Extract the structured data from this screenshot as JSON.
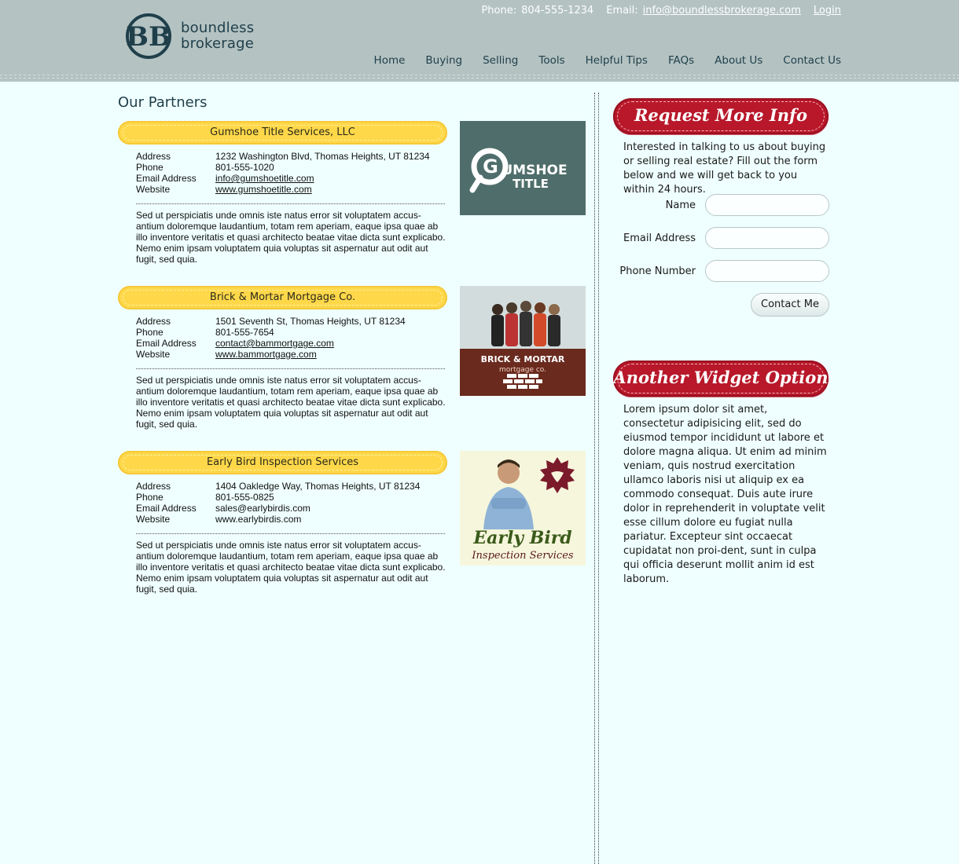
{
  "header": {
    "logo": {
      "mark": "BB",
      "line1": "boundless",
      "line2": "brokerage"
    },
    "phone_label": "Phone:",
    "phone": "804-555-1234",
    "email_label": "Email:",
    "email": "info@boundlessbrokerage.com",
    "login": "Login",
    "nav": [
      "Home",
      "Buying",
      "Selling",
      "Tools",
      "Helpful Tips",
      "FAQs",
      "About Us",
      "Contact Us"
    ]
  },
  "main": {
    "title": "Our Partners",
    "labels": {
      "address": "Address",
      "phone": "Phone",
      "email": "Email Address",
      "website": "Website"
    },
    "partners": [
      {
        "name": "Gumshoe Title Services, LLC",
        "address": "1232 Washington Blvd, Thomas Heights, UT 81234",
        "phone": "801-555-1020",
        "email": "info@gumshoetitle.com",
        "website": "www.gumshoetitle.com",
        "description": "Sed ut perspiciatis unde omnis iste natus error sit voluptatem accus-antium doloremque laudantium, totam rem aperiam, eaque ipsa quae ab illo inventore veritatis et quasi architecto beatae vitae dicta sunt explicabo. Nemo enim ipsam voluptatem quia voluptas sit aspernatur aut odit aut fugit, sed quia.",
        "logo": {
          "line1": "UMSHOE",
          "line2": "TITLE",
          "bg": "#4f6e6b"
        }
      },
      {
        "name": "Brick & Mortar Mortgage Co.",
        "address": "1501 Seventh St, Thomas Heights, UT 81234",
        "phone": "801-555-7654",
        "email": "contact@bammortgage.com",
        "website": "www.bammortgage.com",
        "description": "Sed ut perspiciatis unde omnis iste natus error sit voluptatem accus-antium doloremque laudantium, totam rem aperiam, eaque ipsa quae ab illo inventore veritatis et quasi architecto beatae vitae dicta sunt explicabo. Nemo enim ipsam voluptatem quia voluptas sit aspernatur aut odit aut fugit, sed quia.",
        "logo": {
          "line1": "BRICK & MORTAR",
          "line2": "mortgage co.",
          "bg": "#6a2a1e"
        }
      },
      {
        "name": "Early Bird Inspection Services",
        "address": "1404 Oakledge Way, Thomas Heights, UT 81234",
        "phone": "801-555-0825",
        "email": "sales@earlybirdis.com",
        "website": "www.earlybirdis.com",
        "description": "Sed ut perspiciatis unde omnis iste natus error sit voluptatem accus-antium doloremque laudantium, totam rem aperiam, eaque ipsa quae ab illo inventore veritatis et quasi architecto beatae vitae dicta sunt explicabo. Nemo enim ipsam voluptatem quia voluptas sit aspernatur aut odit aut fugit, sed quia.",
        "logo": {
          "line1": "Early Bird",
          "line2": "Inspection Services",
          "bg": "#f6f6dc"
        }
      }
    ]
  },
  "sidebar": {
    "widget1": {
      "title": "Request More Info",
      "intro": "Interested in talking to us about buying or selling real estate? Fill out the form below and we will get back to you within 24 hours.",
      "fields": [
        {
          "label": "Name",
          "value": ""
        },
        {
          "label": "Email Address",
          "value": ""
        },
        {
          "label": "Phone Number",
          "value": ""
        }
      ],
      "button": "Contact Me"
    },
    "widget2": {
      "title": "Another Widget Option",
      "text": "Lorem ipsum dolor sit amet, consectetur adipisicing elit, sed do eiusmod tempor incididunt ut labore et dolore magna aliqua. Ut enim ad minim veniam, quis nostrud exercitation ullamco laboris nisi ut aliquip ex ea commodo consequat. Duis aute irure dolor in reprehenderit in voluptate velit esse cillum dolore eu fugiat nulla pariatur. Excepteur sint occaecat cupidatat non proi-dent, sunt in culpa qui officia deserunt mollit anim id est laborum."
    }
  },
  "colors": {
    "header": "#b4c2c2",
    "page_bg": "#effefe",
    "pill": "#ffd84a",
    "ribbon": "#b8182a",
    "text_dark": "#1f3f4a"
  }
}
